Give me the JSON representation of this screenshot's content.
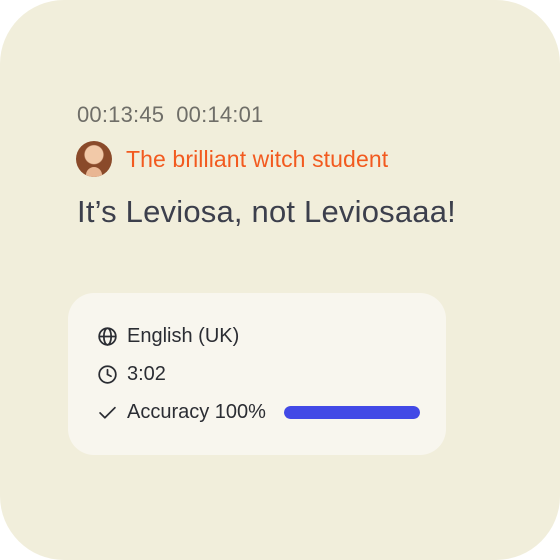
{
  "timestamps": {
    "start": "00:13:45",
    "end": "00:14:01"
  },
  "speaker": {
    "name": "The brilliant witch student",
    "name_color": "#f25a1f",
    "avatar_icon": "avatar-photo"
  },
  "quote": "It’s Leviosa, not Leviosaaa!",
  "details": {
    "language": {
      "icon": "globe-icon",
      "label": "English (UK)"
    },
    "duration": {
      "icon": "clock-icon",
      "label": "3:02"
    },
    "accuracy": {
      "icon": "check-icon",
      "label": "Accuracy 100%",
      "value": 1.0,
      "bar_color": "#4249e6"
    }
  }
}
